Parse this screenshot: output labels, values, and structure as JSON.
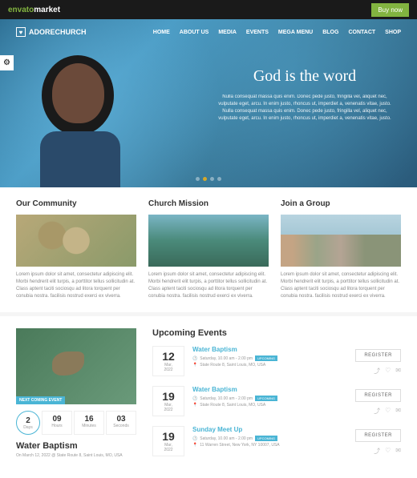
{
  "topbar": {
    "brand_pre": "envato",
    "brand_post": "market",
    "buy": "Buy now"
  },
  "logo": {
    "icon": "♥",
    "text": "ADORECHURCH"
  },
  "nav": [
    "HOME",
    "ABOUT US",
    "MEDIA",
    "EVENTS",
    "MEGA MENU",
    "BLOG",
    "CONTACT",
    "SHOP"
  ],
  "hero": {
    "title": "God is the word",
    "desc": "Nulla consequat massa quis enim. Donec pede justo, fringilla vel, aliquet nec, vulputate eget, arcu. In enim justo, rhoncus ut, imperdiet a, venenatis vitae, justo. Nulla consequat massa quis enim. Donec pede justo, fringilla vel, aliquet nec, vulputate eget, arcu. In enim justo, rhoncus ut, imperdiet a, venenatis vitae, justo."
  },
  "cards": [
    {
      "title": "Our Community",
      "text": "Lorem ipsum dolor sit amet, consectetur adipiscing elit. Morbi hendrerit elit turpis, a porttitor tellus sollicitudin at. Class aptent taciti sociosqu ad litora torquent per conubia nostra. facilisis nostrud exerci ex viverra."
    },
    {
      "title": "Church Mission",
      "text": "Lorem ipsum dolor sit amet, consectetur adipiscing elit. Morbi hendrerit elit turpis, a porttitor tellus sollicitudin at. Class aptent taciti sociosqu ad litora torquent per conubia nostra. facilisis nostrud exerci ex viverra."
    },
    {
      "title": "Join a Group",
      "text": "Lorem ipsum dolor sit amet, consectetur adipiscing elit. Morbi hendrerit elit turpis, a porttitor tellus sollicitudin at. Class aptent taciti sociosqu ad litora torquent per conubia nostra. facilisis nostrud exerci ex viverra."
    }
  ],
  "featured": {
    "badge": "NEXT COMING EVENT",
    "title": "Water Baptism",
    "meta": "On March 12, 2022 @ State Route 8, Saint Louis, MO, USA"
  },
  "countdown": [
    {
      "num": "2",
      "lbl": "Days"
    },
    {
      "num": "09",
      "lbl": "Hours"
    },
    {
      "num": "16",
      "lbl": "Minutes"
    },
    {
      "num": "03",
      "lbl": "Seconds"
    }
  ],
  "upcoming_title": "Upcoming Events",
  "register": "REGISTER",
  "events": [
    {
      "day": "12",
      "mon": "Mar, 2022",
      "title": "Water Baptism",
      "time": "Saturday, 10.00 am - 2.00 pm",
      "tag": "UPCOMING",
      "loc": "State Route 8, Saint Louis, MO, USA"
    },
    {
      "day": "19",
      "mon": "Mar, 2022",
      "title": "Water Baptism",
      "time": "Saturday, 10.00 am - 2.00 pm",
      "tag": "UPCOMING",
      "loc": "State Route 8, Saint Louis, MO, USA"
    },
    {
      "day": "19",
      "mon": "Mar, 2022",
      "title": "Sunday Meet Up",
      "time": "Saturday, 10.00 am - 2.00 pm",
      "tag": "UPCOMING",
      "loc": "11 Warren Street, New York, NY 10007, USA"
    }
  ]
}
